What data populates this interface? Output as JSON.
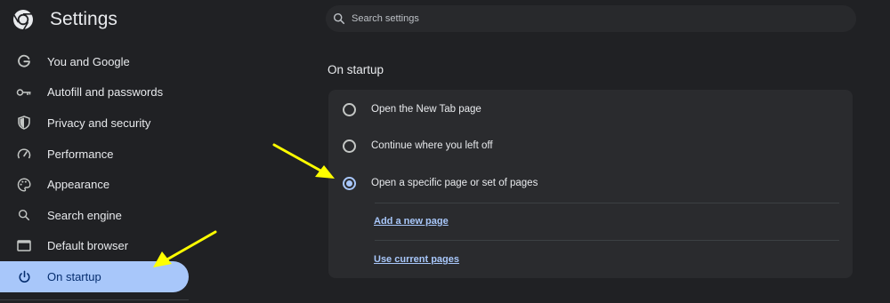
{
  "header": {
    "title": "Settings",
    "logo_icon": "chrome-logo-icon"
  },
  "search": {
    "placeholder": "Search settings",
    "value": ""
  },
  "sidebar": {
    "items": [
      {
        "label": "You and Google",
        "icon": "google-g-icon"
      },
      {
        "label": "Autofill and passwords",
        "icon": "key-icon"
      },
      {
        "label": "Privacy and security",
        "icon": "shield-icon"
      },
      {
        "label": "Performance",
        "icon": "speedometer-icon"
      },
      {
        "label": "Appearance",
        "icon": "palette-icon"
      },
      {
        "label": "Search engine",
        "icon": "search-icon"
      },
      {
        "label": "Default browser",
        "icon": "browser-window-icon"
      },
      {
        "label": "On startup",
        "icon": "power-icon",
        "active": true
      }
    ]
  },
  "section": {
    "title": "On startup",
    "options": [
      {
        "label": "Open the New Tab page",
        "checked": false
      },
      {
        "label": "Continue where you left off",
        "checked": false
      },
      {
        "label": "Open a specific page or set of pages",
        "checked": true
      }
    ],
    "links": {
      "add_page": "Add a new page",
      "use_current": "Use current pages"
    }
  },
  "colors": {
    "background": "#202124",
    "card": "#2a2b2e",
    "accent": "#a8c7fa",
    "active_text": "#062e6f",
    "annotation_arrow": "#ffff00"
  }
}
